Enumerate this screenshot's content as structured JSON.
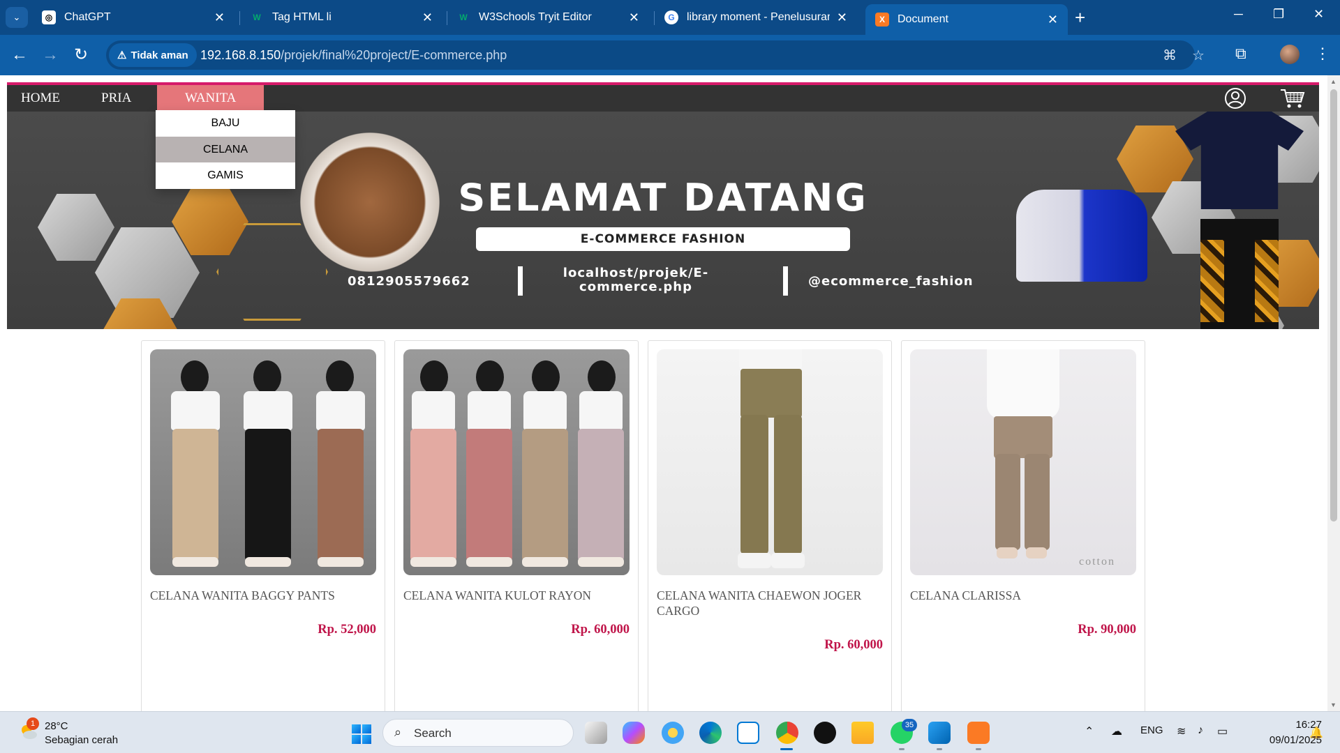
{
  "browser": {
    "tabs": [
      {
        "title": "ChatGPT",
        "icon": "chatgpt-icon"
      },
      {
        "title": "Tag HTML li",
        "icon": "w3schools-icon"
      },
      {
        "title": "W3Schools Tryit Editor",
        "icon": "w3schools-icon"
      },
      {
        "title": "library moment - Penelusuran G",
        "icon": "google-icon"
      },
      {
        "title": "Document",
        "icon": "xampp-icon",
        "active": true
      }
    ],
    "security_label": "Tidak aman",
    "url_host": "192.168.8.150",
    "url_path": "/projek/final%20project/E-commerce.php"
  },
  "nav": {
    "items": [
      "HOME",
      "PRIA",
      "WANITA"
    ],
    "active": "WANITA",
    "dropdown": [
      "BAJU",
      "CELANA",
      "GAMIS"
    ],
    "dropdown_hover": "CELANA"
  },
  "banner": {
    "title": "SELAMAT DATANG",
    "subtitle": "E-COMMERCE FASHION",
    "phone": "0812905579662",
    "site_line1": "localhost/projek/E-",
    "site_line2": "commerce.php",
    "handle": "@ecommerce_fashion"
  },
  "products": [
    {
      "name": "CELANA WANITA BAGGY PANTS",
      "price": "Rp. 52,000"
    },
    {
      "name": "CELANA WANITA KULOT RAYON",
      "price": "Rp. 60,000"
    },
    {
      "name": "CELANA WANITA CHAEWON JOGER CARGO",
      "price": "Rp. 60,000"
    },
    {
      "name": "CELANA CLARISSA",
      "price": "Rp. 90,000",
      "image_caption": "cotton"
    }
  ],
  "taskbar": {
    "weather_temp": "28°C",
    "weather_desc": "Sebagian cerah",
    "weather_badge": "1",
    "search_placeholder": "Search",
    "whatsapp_badge": "35",
    "language": "ENG",
    "time": "16:27",
    "date": "09/01/2025"
  },
  "colors": {
    "accent_pink": "#d61a6a",
    "nav_active": "#e5767a",
    "price": "#c0154a",
    "chrome_blue": "#0f5fa8"
  }
}
